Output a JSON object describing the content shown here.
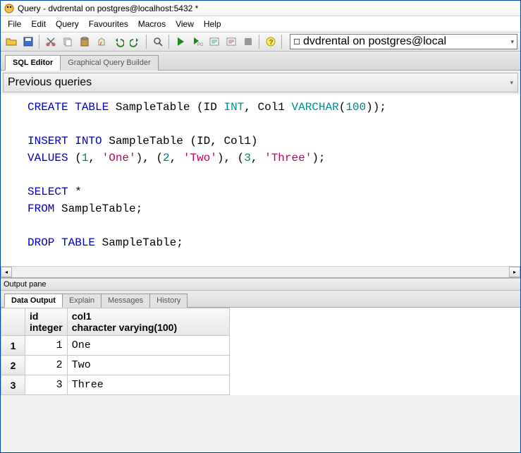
{
  "window": {
    "title": "Query - dvdrental on postgres@localhost:5432 *"
  },
  "menu": {
    "file": "File",
    "edit": "Edit",
    "query": "Query",
    "favourites": "Favourites",
    "macros": "Macros",
    "view": "View",
    "help": "Help"
  },
  "db_selector": {
    "value": "dvdrental on postgres@local"
  },
  "editor_tabs": {
    "sql": "SQL Editor",
    "gqb": "Graphical Query Builder"
  },
  "prev_queries": {
    "label": "Previous queries"
  },
  "sql": {
    "l1a": "CREATE",
    "l1b": "TABLE",
    "l1c": " SampleTable (ID ",
    "l1d": "INT",
    "l1e": ", Col1 ",
    "l1f": "VARCHAR",
    "l1g": "(",
    "l1h": "100",
    "l1i": "));",
    "l2a": "INSERT",
    "l2b": "INTO",
    "l2c": " SampleTable (ID, Col1)",
    "l3a": "VALUES",
    "l3b": " (",
    "l3c": "1",
    "l3d": ", ",
    "l3e": "'One'",
    "l3f": "), (",
    "l3g": "2",
    "l3h": ", ",
    "l3i": "'Two'",
    "l3j": "), (",
    "l3k": "3",
    "l3l": ", ",
    "l3m": "'Three'",
    "l3n": ");",
    "l4a": "SELECT",
    "l4b": " *",
    "l5a": "FROM",
    "l5b": " SampleTable;",
    "l6a": "DROP",
    "l6b": "TABLE",
    "l6c": " SampleTable;"
  },
  "output_pane": {
    "title": "Output pane"
  },
  "out_tabs": {
    "data": "Data Output",
    "explain": "Explain",
    "messages": "Messages",
    "history": "History"
  },
  "result": {
    "col1_name": "id",
    "col1_type": "integer",
    "col2_name": "col1",
    "col2_type": "character varying(100)",
    "r1": "1",
    "r2": "2",
    "r3": "3",
    "c1_1": "1",
    "c1_2": "One",
    "c2_1": "2",
    "c2_2": "Two",
    "c3_1": "3",
    "c3_2": "Three"
  },
  "chart_data": {
    "type": "table",
    "columns": [
      {
        "name": "id",
        "type": "integer"
      },
      {
        "name": "col1",
        "type": "character varying(100)"
      }
    ],
    "rows": [
      {
        "id": 1,
        "col1": "One"
      },
      {
        "id": 2,
        "col1": "Two"
      },
      {
        "id": 3,
        "col1": "Three"
      }
    ]
  }
}
